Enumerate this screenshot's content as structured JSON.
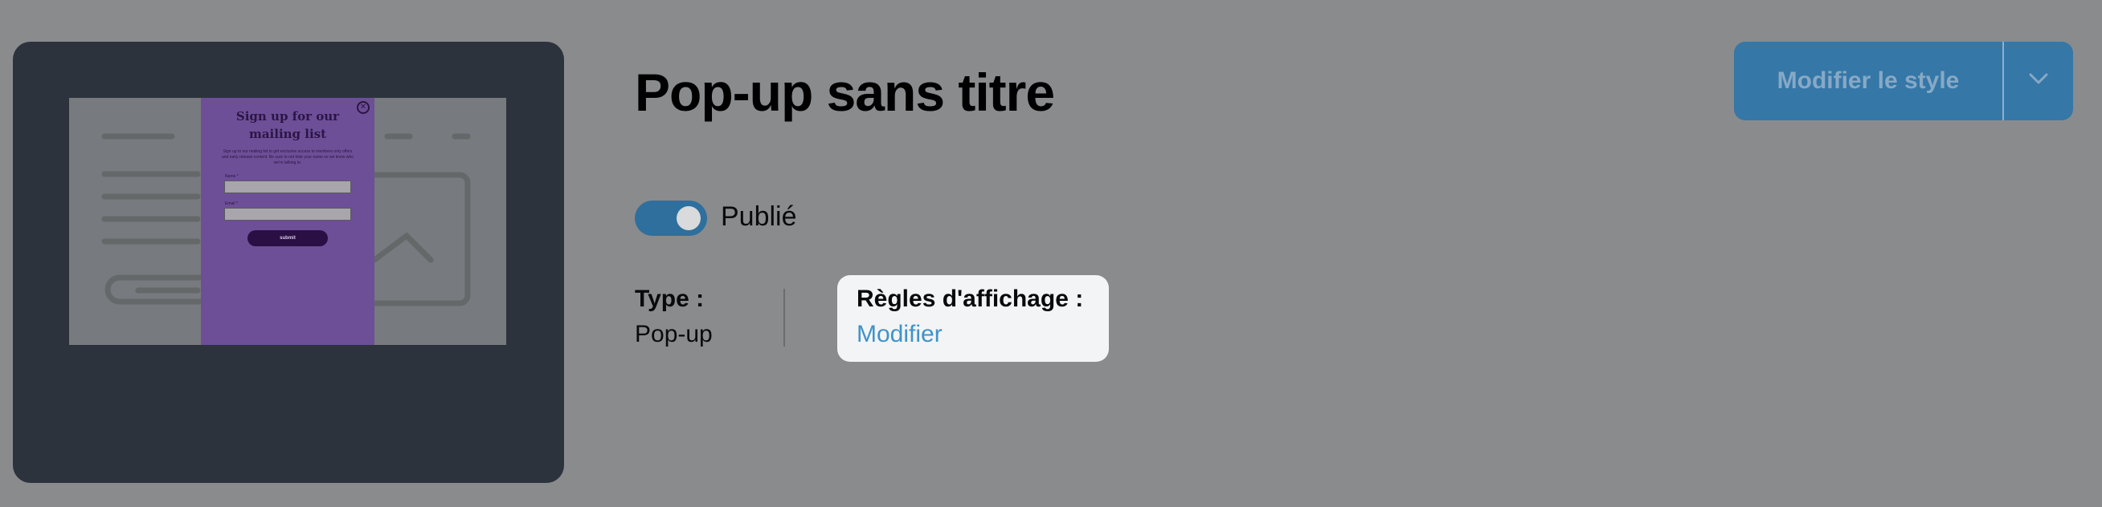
{
  "thumbnail": {
    "popup": {
      "title": "Sign up for our mailing list",
      "body": "Sign up to our mailing list to get exclusive access to members only offers and early release content. Be sure to not hide your name so we know who we're talking to.",
      "field1_label": "Name *",
      "field2_label": "Email *",
      "submit_label": "submit",
      "close_glyph": "✕"
    }
  },
  "header": {
    "title": "Pop-up sans titre"
  },
  "status": {
    "toggle_on": true,
    "label": "Publié"
  },
  "info": {
    "type_label": "Type :",
    "type_value": "Pop-up",
    "rules_label": "Règles d'affichage :",
    "rules_link": "Modifier"
  },
  "actions": {
    "style_button": "Modifier le style",
    "dropdown_icon": "chevron-down-icon"
  },
  "colors": {
    "overlay": "#8a8b8d",
    "primary": "#3577a7",
    "link": "#3f93c9",
    "popup": "#6d4f97"
  }
}
